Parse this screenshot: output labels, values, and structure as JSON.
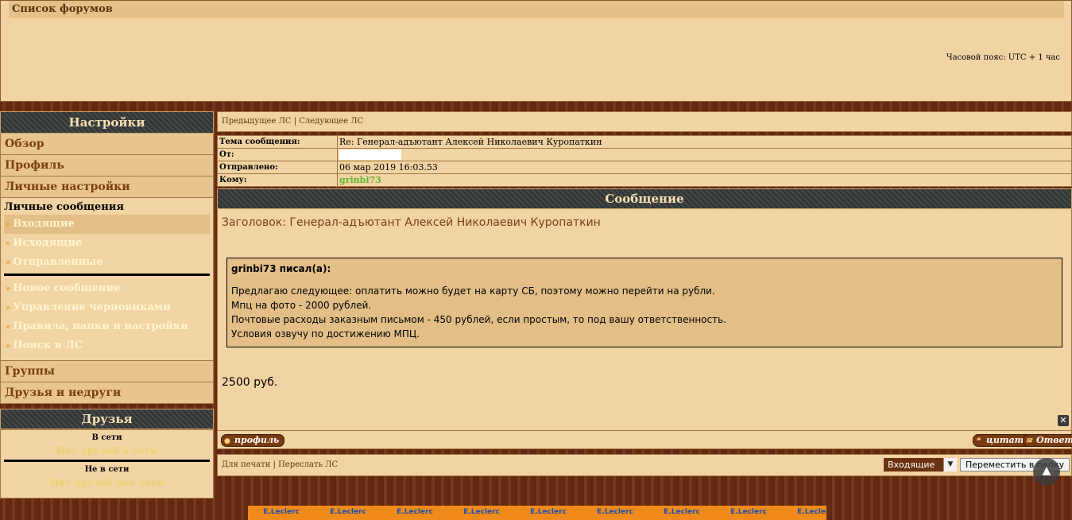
{
  "top": {
    "forums_title": "Список форумов",
    "timezone": "Часовой пояс: UTC + 1 час"
  },
  "sidebar": {
    "settings_header": "Настройки",
    "items_top": [
      "Обзор",
      "Профиль",
      "Личные настройки"
    ],
    "pm_title": "Личные сообщения",
    "pm_folders": [
      "Входящие",
      "Исходящие",
      "Отправленные"
    ],
    "pm_actions": [
      "Новое сообщение",
      "Управление черновиками",
      "Правила, папки и настройки",
      "Поиск в ЛС"
    ],
    "items_bottom": [
      "Группы",
      "Друзья и недруги"
    ],
    "friends_header": "Друзья",
    "online_label": "В сети",
    "online_empty": "Нет друзей в сети",
    "offline_label": "Не в сети",
    "offline_empty": "Нет друзей вне сети"
  },
  "nav": {
    "prev": "Предыдущее ЛС",
    "separator": "|",
    "next": "Следующее ЛС"
  },
  "meta": {
    "subject_label": "Тема сообщения:",
    "subject_value": "Re: Генерал-адъютант Алексей Николаевич Куропаткин",
    "from_label": "От:",
    "sent_label": "Отправлено:",
    "sent_value": "06 мар 2019 16:03.53",
    "to_label": "Кому:",
    "to_value": "grinbi73"
  },
  "message": {
    "header": "Сообщение",
    "subject": "Заголовок: Генерал-адъютант Алексей Николаевич Куропаткин",
    "quote_author": "grinbi73 писал(а):",
    "quote_lines": [
      "Предлагаю следующее: оплатить можно будет на карту СБ, поэтому можно перейти на рубли.",
      "Мпц на фото - 2000 рублей.",
      "Почтовые расходы заказным письмом - 450 рублей, если простым, то под вашу ответственность.",
      "Условия озвучу по достижению МПЦ."
    ],
    "price": "2500 руб.",
    "close_glyph": "✕"
  },
  "buttons": {
    "profile": "профиль",
    "quote": "цитата",
    "reply": "Ответ"
  },
  "footer": {
    "print": "Для печати",
    "forward": "Переслать ЛС",
    "folder_select": "Входящие",
    "move_button": "Переместить в папку"
  },
  "banner": {
    "logo_text": "E.Leclerc"
  },
  "colors": {
    "panel": "#f2d3a3",
    "accent": "#7a3e10",
    "online_green": "#5fb82a"
  }
}
